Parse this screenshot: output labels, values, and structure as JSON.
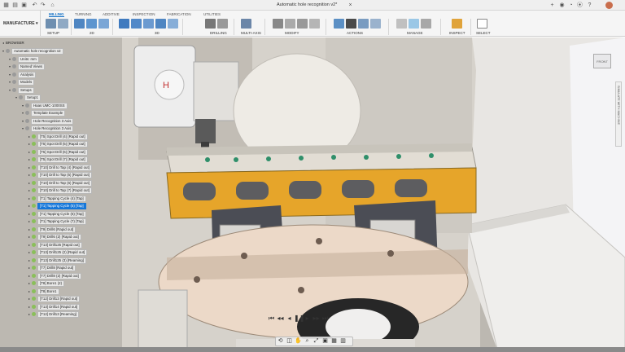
{
  "window": {
    "title": "Automatic hole recognition v2*"
  },
  "ribbon": {
    "workspace": "MANUFACTURE",
    "tabs": [
      "MILLING",
      "TURNING",
      "ADDITIVE",
      "INSPECTION",
      "FABRICATION",
      "UTILITIES"
    ],
    "active_tab": "MILLING",
    "groups": [
      "SETUP",
      "2D",
      "3D",
      "DRILLING",
      "MULTI-AXIS",
      "MODIFY",
      "ACTIONS",
      "MANAGE",
      "INSPECT",
      "SELECT"
    ]
  },
  "browser": {
    "header": "BROWSER",
    "items": [
      {
        "label": "Automatic hole recognition v2",
        "level": 0,
        "type": "doc"
      },
      {
        "label": "Units: mm",
        "level": 1,
        "type": "folder"
      },
      {
        "label": "Named Views",
        "level": 1,
        "type": "folder"
      },
      {
        "label": "Analysis",
        "level": 1,
        "type": "folder"
      },
      {
        "label": "Models",
        "level": 1,
        "type": "folder"
      },
      {
        "label": "Setups",
        "level": 1,
        "type": "folder"
      },
      {
        "label": "Setup1",
        "level": 2,
        "type": "setup"
      },
      {
        "label": "Haas UMC-1000SS",
        "level": 3,
        "type": "machine"
      },
      {
        "label": "Template Example",
        "level": 3,
        "type": "folder"
      },
      {
        "label": "Hole Recognition 3 Axis",
        "level": 3,
        "type": "folder"
      },
      {
        "label": "Hole Recognition 3 Axis",
        "level": 3,
        "type": "folder"
      },
      {
        "label": "[T5] Spot Drill (4) [Rapid out]",
        "level": 4,
        "type": "op"
      },
      {
        "label": "[T5] Spot Drill (5) [Rapid out]",
        "level": 4,
        "type": "op"
      },
      {
        "label": "[T5] Spot Drill (6) [Rapid out]",
        "level": 4,
        "type": "op"
      },
      {
        "label": "[T5] Spot Drill (7) [Rapid out]",
        "level": 4,
        "type": "op"
      },
      {
        "label": "[T10] Drill to Tap (4) [Rapid out]",
        "level": 4,
        "type": "op"
      },
      {
        "label": "[T10] Drill to Tap (5) [Rapid out]",
        "level": 4,
        "type": "op"
      },
      {
        "label": "[T10] Drill to Tap (6) [Rapid out]",
        "level": 4,
        "type": "op"
      },
      {
        "label": "[T10] Drill to Tap (7) [Rapid out]",
        "level": 4,
        "type": "op"
      },
      {
        "label": "[T1] Tapping Cycle (4) [Tap]",
        "level": 4,
        "type": "op"
      },
      {
        "label": "[T1] Tapping Cycle (5) [Tap]",
        "level": 4,
        "type": "op",
        "selected": true
      },
      {
        "label": "[T1] Tapping Cycle (6) [Tap]",
        "level": 4,
        "type": "op"
      },
      {
        "label": "[T1] Tapping Cycle (7) [Tap]",
        "level": 4,
        "type": "op"
      },
      {
        "label": "[T9] Drill6 [Rapid out]",
        "level": 4,
        "type": "op"
      },
      {
        "label": "[T9] Drill6 (2) [Rapid out]",
        "level": 4,
        "type": "op"
      },
      {
        "label": "[T13] Drill125 [Rapid out]",
        "level": 4,
        "type": "op"
      },
      {
        "label": "[T13] Drill125 (2) [Rapid out]",
        "level": 4,
        "type": "op"
      },
      {
        "label": "[T13] Drill125 (3) [Reaming]",
        "level": 4,
        "type": "op"
      },
      {
        "label": "[T7] Drill8 [Rapid out]",
        "level": 4,
        "type": "op"
      },
      {
        "label": "[T7] Drill8 (2) [Rapid out]",
        "level": 4,
        "type": "op"
      },
      {
        "label": "[T8] Bore1 (2)",
        "level": 4,
        "type": "op"
      },
      {
        "label": "[T8] Bore1",
        "level": 4,
        "type": "op"
      },
      {
        "label": "[T12] Drill13 [Rapid out]",
        "level": 4,
        "type": "op"
      },
      {
        "label": "[T13] Drill14 [Rapid out]",
        "level": 4,
        "type": "op"
      },
      {
        "label": "[T12] Drill13 [Reaming]",
        "level": 4,
        "type": "op"
      }
    ]
  },
  "viewcube": {
    "face": "FRONT"
  },
  "side_panel": {
    "label": "SIMULATE WITH MACHINE"
  },
  "colors": {
    "accent": "#0f6fc6",
    "selection": "#1677d9",
    "part_orange": "#e6a52a",
    "check_green": "#8abf5a"
  }
}
